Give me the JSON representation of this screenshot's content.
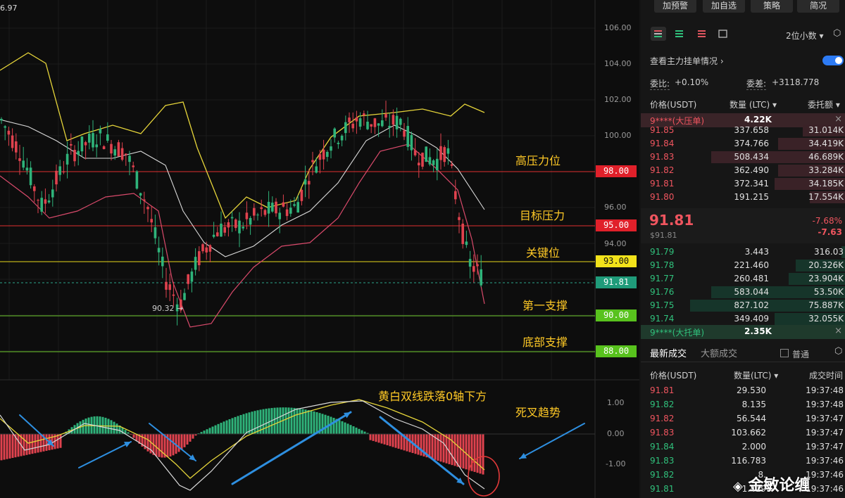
{
  "chart": {
    "top_left_value": "6.97",
    "low_marker": "90.32 →",
    "axis": {
      "price_ticks": [
        "106.00",
        "104.00",
        "102.00",
        "100.00",
        "96.00",
        "94.00"
      ],
      "macd_ticks": [
        "1.00",
        "0.00",
        "-1.00"
      ]
    },
    "levels": [
      {
        "label": "98.00",
        "color": "#e0202a",
        "text_color": "#ffffff",
        "line": "#e03030"
      },
      {
        "label": "95.00",
        "color": "#e0202a",
        "text_color": "#ffffff",
        "line": "#e03030"
      },
      {
        "label": "93.00",
        "color": "#f2e21a",
        "text_color": "#111111",
        "line": "#e8d81a"
      },
      {
        "label": "91.81",
        "color": "#1f9b7a",
        "text_color": "#ffffff",
        "line": "#2aa58a"
      },
      {
        "label": "90.00",
        "color": "#58c21d",
        "text_color": "#ffffff",
        "line": "#6cc82a"
      },
      {
        "label": "88.00",
        "color": "#58c21d",
        "text_color": "#ffffff",
        "line": "#6cc82a"
      }
    ],
    "annotations": [
      "高压力位",
      "目标压力",
      "关键位",
      "第一支撑",
      "底部支撑",
      "黄白双线跌落0轴下方",
      "死叉趋势"
    ]
  },
  "panel": {
    "top_buttons": [
      "加预警",
      "加自选",
      "策略",
      "简况"
    ],
    "precision": "2位小数",
    "precision_arrow": "▾",
    "main_orders_label": "查看主力挂单情况",
    "main_orders_arrow": "›",
    "wei_bi_label": "委比:",
    "wei_bi_value": "+0.10%",
    "wei_cha_label": "委差:",
    "wei_cha_value": "+3118.778",
    "book_headers": {
      "price": "价格(USDT)",
      "qty": "数量 (LTC)",
      "total": "委托额"
    },
    "big_sell": {
      "name": "9****(大压单)",
      "qty": "4.22K"
    },
    "asks": [
      {
        "price": "91.85",
        "qty": "337.658",
        "total": "31.014K"
      },
      {
        "price": "91.84",
        "qty": "374.766",
        "total": "34.419K"
      },
      {
        "price": "91.83",
        "qty": "508.434",
        "total": "46.689K"
      },
      {
        "price": "91.82",
        "qty": "362.490",
        "total": "33.284K"
      },
      {
        "price": "91.81",
        "qty": "372.341",
        "total": "34.185K"
      },
      {
        "price": "91.80",
        "qty": "191.215",
        "total": "17.554K"
      }
    ],
    "last_price": "91.81",
    "last_price_sub": "$91.81",
    "change_pct": "-7.68%",
    "change_abs": "-7.63",
    "bids": [
      {
        "price": "91.79",
        "qty": "3.443",
        "total": "316.03"
      },
      {
        "price": "91.78",
        "qty": "221.460",
        "total": "20.326K"
      },
      {
        "price": "91.77",
        "qty": "260.481",
        "total": "23.904K"
      },
      {
        "price": "91.76",
        "qty": "583.044",
        "total": "53.50K"
      },
      {
        "price": "91.75",
        "qty": "827.102",
        "total": "75.887K"
      },
      {
        "price": "91.74",
        "qty": "349.409",
        "total": "32.055K"
      }
    ],
    "big_buy": {
      "name": "9****(大托单)",
      "qty": "2.35K"
    },
    "trades_tab_active": "最新成交",
    "trades_tab_big": "大额成交",
    "ordinary_label": "普通",
    "trade_headers": {
      "price": "价格(USDT)",
      "qty": "数量(LTC)",
      "time": "成交时间"
    },
    "trades": [
      {
        "price": "91.81",
        "qty": "29.530",
        "time": "19:37:48",
        "side": "red"
      },
      {
        "price": "91.82",
        "qty": "8.135",
        "time": "19:37:48",
        "side": "green"
      },
      {
        "price": "91.82",
        "qty": "56.544",
        "time": "19:37:47",
        "side": "red"
      },
      {
        "price": "91.83",
        "qty": "103.662",
        "time": "19:37:47",
        "side": "red"
      },
      {
        "price": "91.84",
        "qty": "2.000",
        "time": "19:37:47",
        "side": "green"
      },
      {
        "price": "91.83",
        "qty": "116.783",
        "time": "19:37:46",
        "side": "green"
      },
      {
        "price": "91.82",
        "qty": "8.",
        "time": "19:37:46",
        "side": "green"
      },
      {
        "price": "91.81",
        "qty": "1.419",
        "time": "19:37:46",
        "side": "green"
      }
    ],
    "watermark": "金敏论缠",
    "colors": {
      "up": "#30c17c",
      "down": "#f0555f",
      "toggle": "#2d7bf4"
    }
  }
}
